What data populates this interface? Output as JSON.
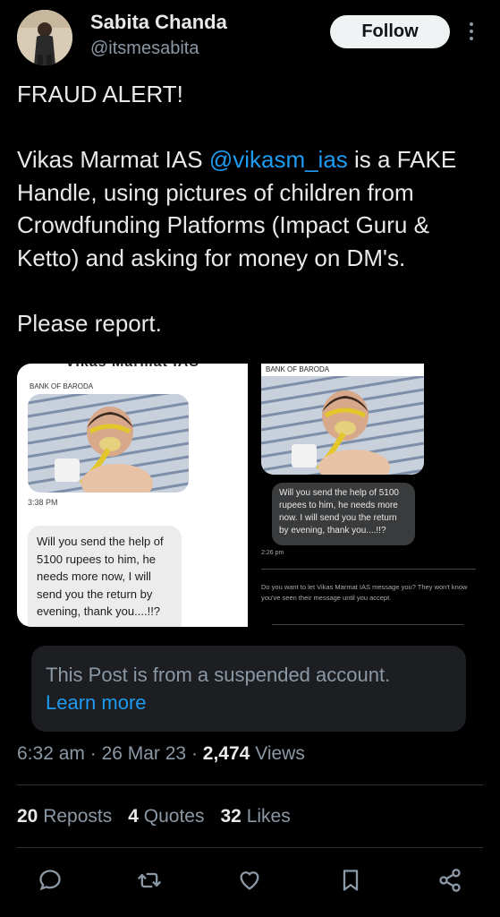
{
  "author": {
    "name": "Sabita Chanda",
    "handle": "@itsmesabita",
    "follow_label": "Follow"
  },
  "post": {
    "line_alert": "FRAUD ALERT!",
    "line_intro": "Vikas Marmat IAS ",
    "mention": "@vikasm_ias",
    "line_rest": " is a FAKE Handle, using pictures of children from Crowdfunding Platforms (Impact Guru & Ketto) and asking for money on DM's.",
    "line_report": "Please report."
  },
  "media": {
    "left": {
      "top_title": "Vikas Marmat IAS",
      "bank": "BANK OF BARODA",
      "time": "3:38 PM",
      "message": "Will you send the help of 5100 rupees to him, he needs more now, I will send you the return by evening, thank you....!!?"
    },
    "right": {
      "bank": "BANK OF BARODA",
      "message": "Will you send the help of 5100 rupees to him, he needs more now. I will send you the return by evening, thank you....!!?",
      "time": "2:26 pm",
      "note": "Do you want to let Vikas Marmat IAS message you? They won't know you've seen their message until you accept."
    }
  },
  "notice": {
    "text": "This Post is from a suspended account.",
    "link": "Learn more"
  },
  "meta": {
    "time": "6:32 am",
    "date": "26 Mar 23",
    "views_count": "2,474",
    "views_label": "Views"
  },
  "stats": {
    "reposts_count": "20",
    "reposts_label": "Reposts",
    "quotes_count": "4",
    "quotes_label": "Quotes",
    "likes_count": "32",
    "likes_label": "Likes"
  },
  "colors": {
    "background": "#000000",
    "text": "#e7e9ea",
    "secondary": "#8b98a5",
    "link": "#1d9bf0"
  },
  "icons": [
    "reply-icon",
    "repost-icon",
    "like-icon",
    "bookmark-icon",
    "share-icon",
    "more-icon"
  ]
}
